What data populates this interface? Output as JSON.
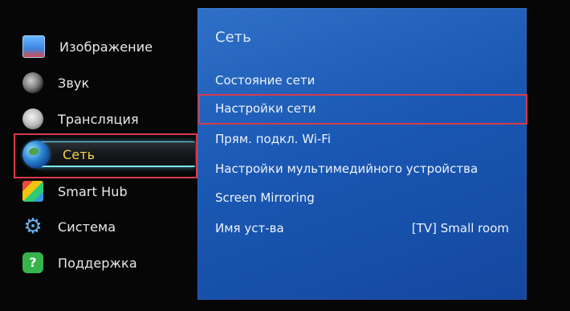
{
  "left_menu": {
    "items": [
      {
        "label": "Изображение",
        "icon": "picture-icon"
      },
      {
        "label": "Звук",
        "icon": "speaker-icon"
      },
      {
        "label": "Трансляция",
        "icon": "satellite-dish-icon"
      },
      {
        "label": "Сеть",
        "icon": "globe-icon",
        "selected": true
      },
      {
        "label": "Smart Hub",
        "icon": "smart-hub-cube-icon"
      },
      {
        "label": "Система",
        "icon": "gear-icon"
      },
      {
        "label": "Поддержка",
        "icon": "support-chat-icon"
      }
    ]
  },
  "network_panel": {
    "title": "Сеть",
    "items": [
      {
        "label": "Состояние сети"
      },
      {
        "label": "Настройки сети",
        "highlighted": true
      },
      {
        "label": "Прям. подкл. Wi-Fi"
      },
      {
        "label": "Настройки мультимедийного устройства"
      },
      {
        "label": "Screen Mirroring"
      },
      {
        "label": "Имя уст-ва",
        "value": "[TV] Small room"
      }
    ]
  },
  "colors": {
    "panel_blue": "#1a58b3",
    "selected_label": "#f1d548",
    "highlight_frame": "#d93b4a"
  }
}
